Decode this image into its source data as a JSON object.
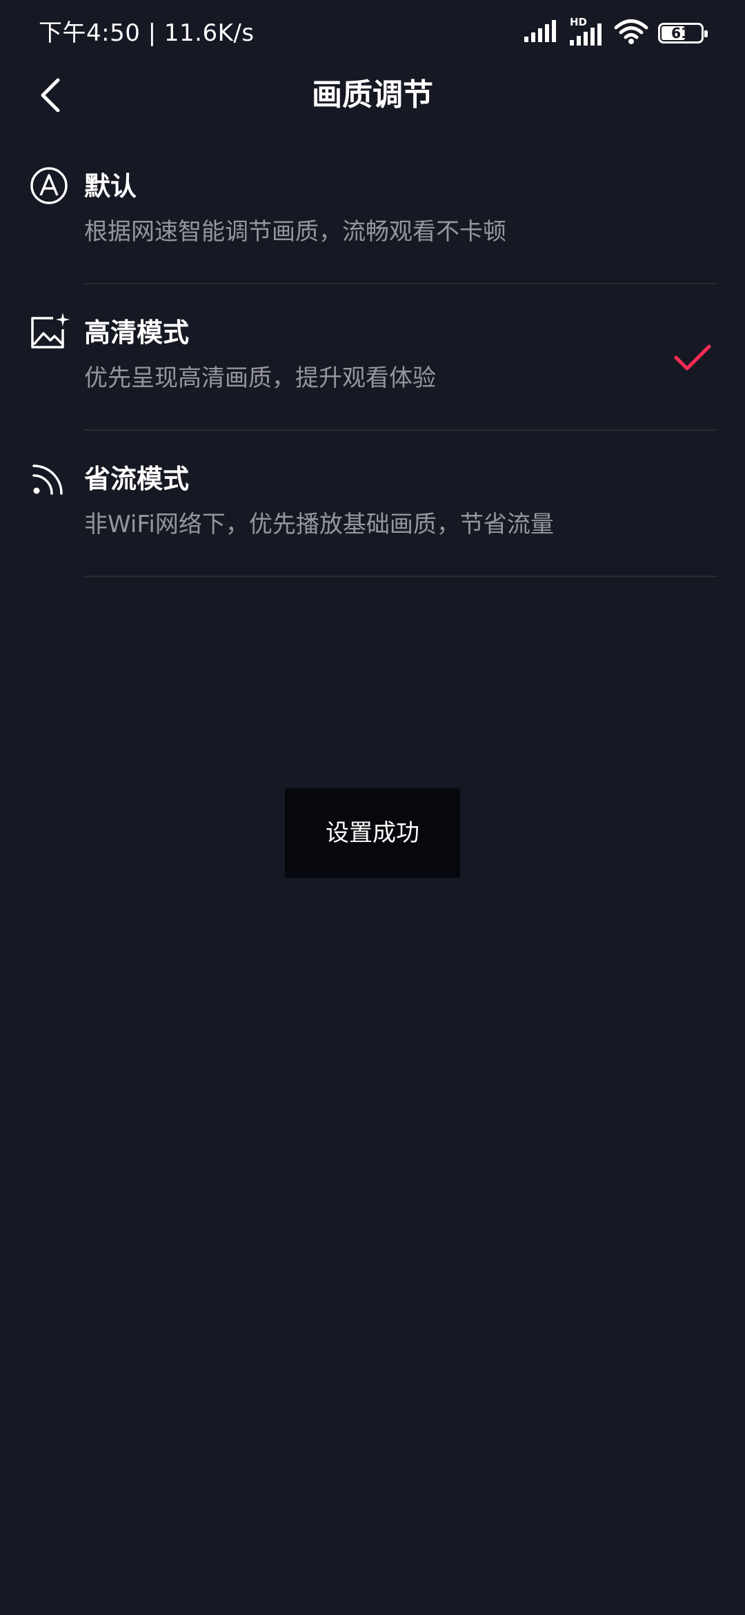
{
  "colors": {
    "background": "#161823",
    "accent_check": "#fe2c55",
    "toast_background": "#07080d"
  },
  "status_bar": {
    "left_text": "下午4:50 | 11.6K/s",
    "network_label": "HD",
    "battery_level": "61",
    "battery_fraction": 0.61,
    "icons": [
      "signal-icon",
      "hd-signal-icon",
      "wifi-icon",
      "battery-icon"
    ]
  },
  "header": {
    "back_icon": "chevron-left-icon",
    "title": "画质调节"
  },
  "options": [
    {
      "icon": "auto-a-icon",
      "title": "默认",
      "description": "根据网速智能调节画质，流畅观看不卡顿",
      "selected": false
    },
    {
      "icon": "hd-image-icon",
      "title": "高清模式",
      "description": "优先呈现高清画质，提升观看体验",
      "selected": true
    },
    {
      "icon": "feed-signal-icon",
      "title": "省流模式",
      "description": "非WiFi网络下，优先播放基础画质，节省流量",
      "selected": false
    }
  ],
  "toast": {
    "message": "设置成功"
  }
}
